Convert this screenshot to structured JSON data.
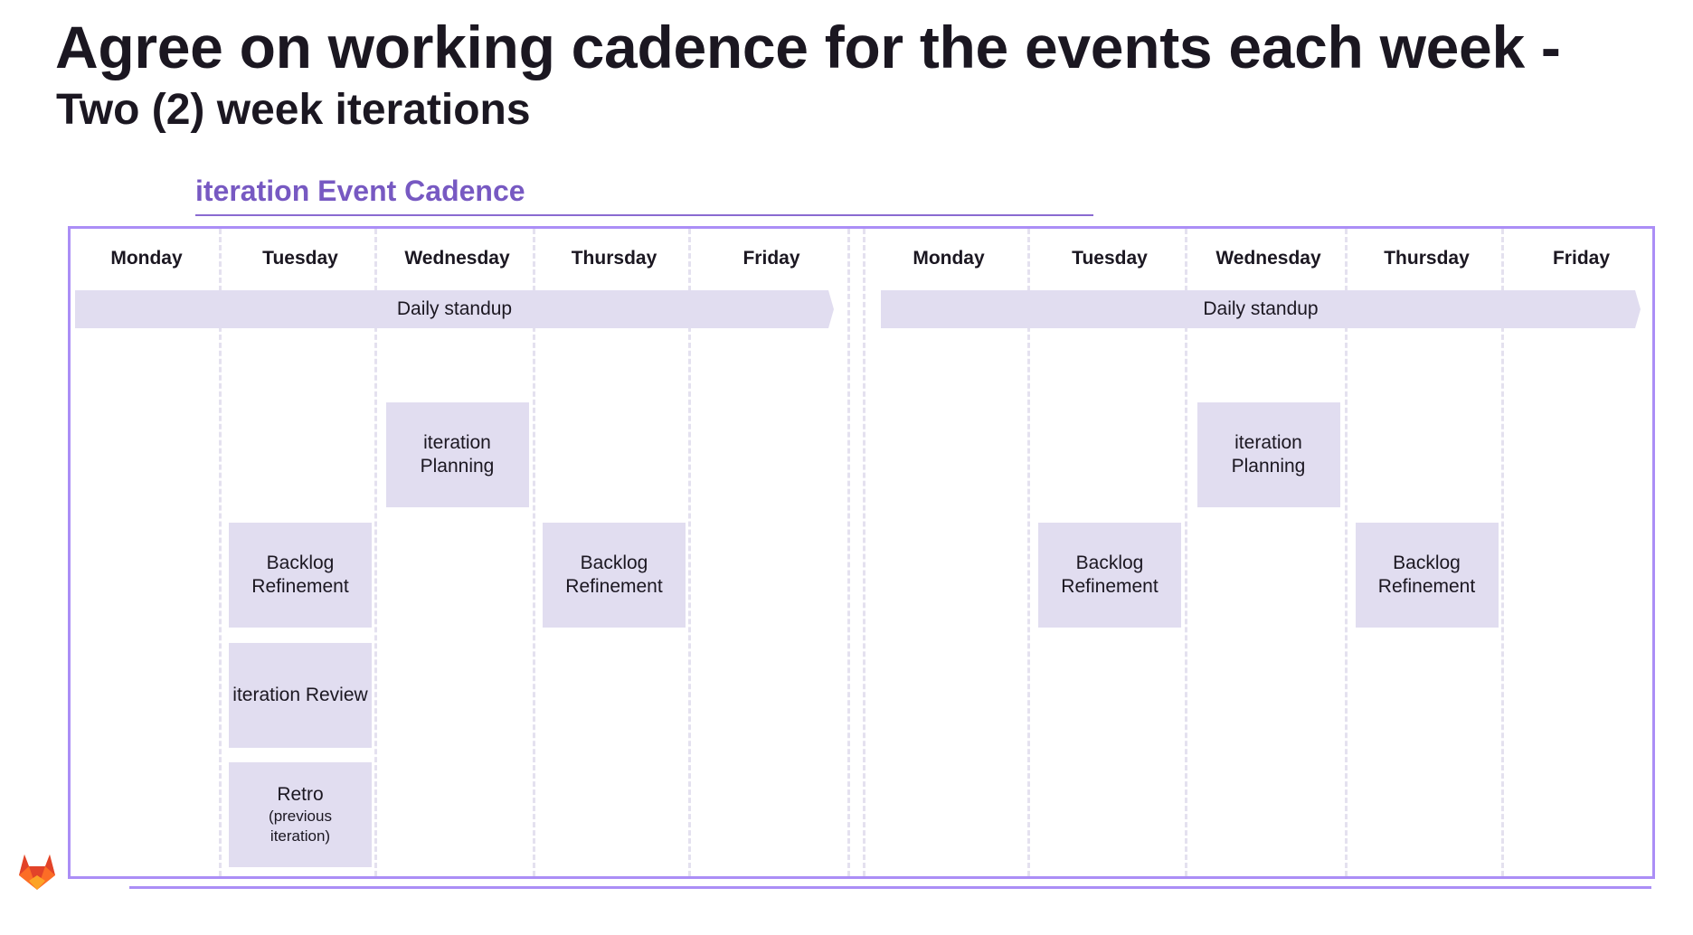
{
  "header": {
    "title": "Agree on working cadence for the events each week -",
    "subtitle": "Two (2) week iterations"
  },
  "section": {
    "title": "iteration Event Cadence"
  },
  "weeks": [
    {
      "days": [
        "Monday",
        "Tuesday",
        "Wednesday",
        "Thursday",
        "Friday"
      ],
      "standup_label": "Daily standup",
      "events": [
        {
          "day": "Wednesday",
          "row": 0,
          "lines": [
            "iteration",
            "Planning"
          ],
          "sub": []
        },
        {
          "day": "Tuesday",
          "row": 1,
          "lines": [
            "Backlog",
            "Refinement"
          ],
          "sub": []
        },
        {
          "day": "Thursday",
          "row": 1,
          "lines": [
            "Backlog",
            "Refinement"
          ],
          "sub": []
        },
        {
          "day": "Tuesday",
          "row": 2,
          "lines": [
            "iteration Review"
          ],
          "sub": []
        },
        {
          "day": "Tuesday",
          "row": 3,
          "lines": [
            "Retro"
          ],
          "sub": [
            "(previous",
            "iteration)"
          ]
        }
      ]
    },
    {
      "days": [
        "Monday",
        "Tuesday",
        "Wednesday",
        "Thursday",
        "Friday"
      ],
      "standup_label": "Daily standup",
      "events": [
        {
          "day": "Wednesday",
          "row": 0,
          "lines": [
            "iteration",
            "Planning"
          ],
          "sub": []
        },
        {
          "day": "Tuesday",
          "row": 1,
          "lines": [
            "Backlog",
            "Refinement"
          ],
          "sub": []
        },
        {
          "day": "Thursday",
          "row": 1,
          "lines": [
            "Backlog",
            "Refinement"
          ],
          "sub": []
        }
      ]
    }
  ],
  "footer": {
    "logo_icon": "gitlab-tanuki-icon"
  },
  "colors": {
    "title_text": "#1b1721",
    "section_title": "#7759c2",
    "frame_border": "#ab8ef6",
    "event_fill": "#e1ddf0",
    "divider": "#e4e1ef",
    "logo_orange": "#fc6d26",
    "logo_red": "#e24329",
    "logo_yellow": "#fca326"
  }
}
